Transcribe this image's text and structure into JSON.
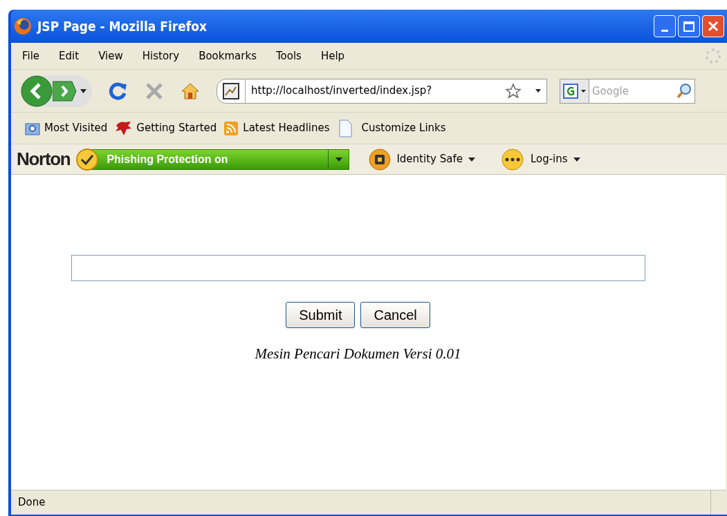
{
  "window": {
    "title": "JSP Page - Mozilla Firefox"
  },
  "menu": [
    "File",
    "Edit",
    "View",
    "History",
    "Bookmarks",
    "Tools",
    "Help"
  ],
  "address": {
    "value": "http://localhost/inverted/index.jsp?"
  },
  "search": {
    "placeholder": "Google"
  },
  "bookmarks": [
    {
      "label": "Most Visited",
      "kind": "folder"
    },
    {
      "label": "Getting Started",
      "kind": "creature"
    },
    {
      "label": "Latest Headlines",
      "kind": "feed"
    },
    {
      "label": "Customize Links",
      "kind": "page"
    }
  ],
  "norton": {
    "brand": "Norton",
    "status": "Phishing Protection on",
    "menus": [
      {
        "label": "Identity Safe",
        "kind": "lock"
      },
      {
        "label": "Log-ins",
        "kind": "password"
      }
    ]
  },
  "form": {
    "buttons": [
      "Submit",
      "Cancel"
    ],
    "caption": "Mesin Pencari Dokumen Versi 0.01"
  },
  "status_bar": "Done"
}
